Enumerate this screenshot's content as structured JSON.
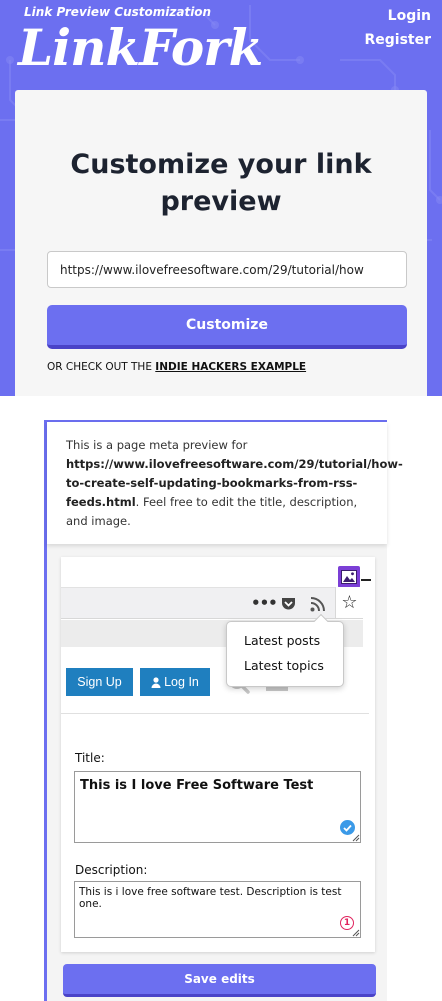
{
  "brand": {
    "tagline": "Link Preview Customization",
    "logo_text": "LinkFork"
  },
  "nav": {
    "login": "Login",
    "register": "Register"
  },
  "hero": {
    "heading": "Customize your link preview",
    "url_value": "https://www.ilovefreesoftware.com/29/tutorial/how",
    "customize_label": "Customize",
    "checkout_prefix": "OR CHECK OUT THE ",
    "checkout_link": "INDIE HACKERS EXAMPLE"
  },
  "meta_preview": {
    "intro": "This is a page meta preview for",
    "url": "https://www.ilovefreesoftware.com/29/tutorial/how-to-create-self-updating-bookmarks-from-rss-feeds.html",
    "outro": ". Feel free to edit the title, description, and image."
  },
  "screenshot": {
    "dropdown": {
      "item1": "Latest posts",
      "item2": "Latest topics"
    },
    "signup": "Sign Up",
    "login": "Log In"
  },
  "editor": {
    "title_label": "Title:",
    "title_value": "This is I love Free Software Test",
    "description_label": "Description:",
    "description_value": "This is i love free software test. Description is test one.",
    "warning_count": "1",
    "save_label": "Save edits"
  },
  "icons": {
    "image_badge": "image-edit-icon",
    "ellipsis": "ellipsis-icon",
    "pocket": "pocket-icon",
    "rss": "rss-icon",
    "star": "star-icon",
    "user": "user-icon",
    "search": "search-icon",
    "check": "check-icon",
    "warning": "warning-icon"
  },
  "colors": {
    "brand": "#6c6ff0",
    "brand_dark": "#4a43c8",
    "button_blue": "#1f7fbf",
    "check": "#3b9ae8",
    "warning": "#e0245e"
  }
}
